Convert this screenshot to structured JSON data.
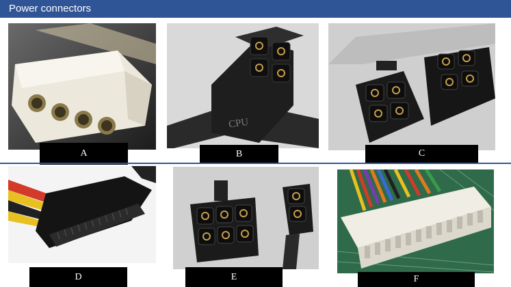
{
  "header": {
    "title": "Power connectors"
  },
  "photos": [
    {
      "label": "A",
      "subject": "molex-4-pin-connector"
    },
    {
      "label": "B",
      "subject": "cpu-4-pin-connector",
      "imprint": "CPU"
    },
    {
      "label": "C",
      "subject": "eps-8-pin-split-connector"
    },
    {
      "label": "D",
      "subject": "sata-power-connector"
    },
    {
      "label": "E",
      "subject": "pcie-6-plus-2-pin-connector"
    },
    {
      "label": "F",
      "subject": "atx-24-pin-motherboard-connector"
    }
  ],
  "colors": {
    "header": "#2f5597",
    "divider": "#2f5597",
    "label_bg": "#000000",
    "label_text": "#ffffff"
  }
}
